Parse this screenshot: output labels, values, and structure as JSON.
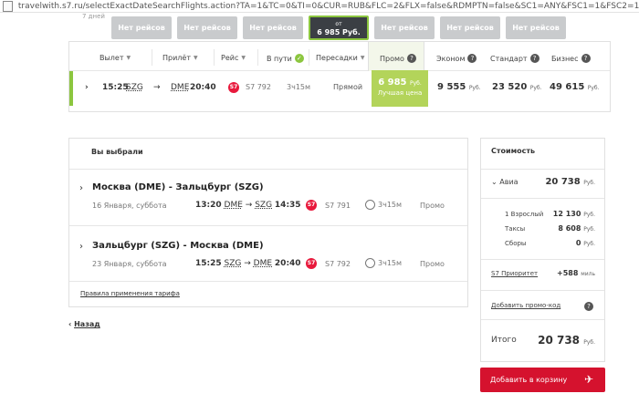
{
  "browser": {
    "url": "travelwith.s7.ru/selectExactDateSearchFlights.action?TA=1&TC=0&TI=0&CUR=RUB&FLC=2&FLX=false&RDMPTN=false&SC1=ANY&FSC1=1&FSC2=1&"
  },
  "date_tabs": {
    "side_label": "7 дней",
    "items": [
      {
        "label": "Нет рейсов"
      },
      {
        "label": "Нет рейсов"
      },
      {
        "label": "Нет рейсов"
      },
      {
        "label_top": "от",
        "label_bottom": "6 985 Руб."
      },
      {
        "label": "Нет рейсов"
      },
      {
        "label": "Нет рейсов"
      },
      {
        "label": "Нет рейсов"
      }
    ]
  },
  "columns": {
    "depart": "Вылет",
    "arrive": "Прилёт",
    "flight": "Рейс",
    "duration": "В пути",
    "stops": "Пересадки",
    "promo": "Промо",
    "economy": "Эконом",
    "standard": "Стандарт",
    "business": "Бизнес"
  },
  "flight_row": {
    "dep_time": "15:25",
    "dep_code": "SZG",
    "arrow": "→",
    "arr_code": "DME",
    "arr_time": "20:40",
    "airline": "S7",
    "flight_no": "S7 792",
    "duration": "3ч15м",
    "stops": "Прямой",
    "promo_price": "6 985",
    "promo_currency": "Руб.",
    "promo_note": "Лучшая цена",
    "economy_price": "9 555",
    "standard_price": "23 520",
    "business_price": "49 615",
    "currency": "Руб."
  },
  "chosen": {
    "title": "Вы выбрали",
    "segments": [
      {
        "route": "Москва (DME) - Зальцбург (SZG)",
        "date": "16 Января, суббота",
        "dep_time": "13:20",
        "dep_code": "DME",
        "arr_code": "SZG",
        "arr_time": "14:35",
        "flight_no": "S7 791",
        "duration": "3ч15м",
        "fare_class": "Промо"
      },
      {
        "route": "Зальцбург (SZG) - Москва (DME)",
        "date": "23 Января, суббота",
        "dep_time": "15:25",
        "dep_code": "SZG",
        "arr_code": "DME",
        "arr_time": "20:40",
        "flight_no": "S7 792",
        "duration": "3ч15м",
        "fare_class": "Промо"
      }
    ],
    "tariff_link": "Правила применения тарифа"
  },
  "back_link": "Назад",
  "cost": {
    "title": "Стоимость",
    "avia_label": "Авиа",
    "avia_value": "20 738",
    "adult_label": "1 Взрослый",
    "adult_value": "12 130",
    "taxes_label": "Таксы",
    "taxes_value": "8 608",
    "fees_label": "Сборы",
    "fees_value": "0",
    "currency": "Руб.",
    "priority_label": "S7 Приоритет",
    "priority_value": "+588",
    "priority_unit": "миль",
    "promo_code_label": "Добавить промо-код",
    "total_label": "Итого",
    "total_value": "20 738"
  },
  "cart_button": "Добавить в корзину",
  "colors": {
    "accent_green": "#8cc63f",
    "promo_green": "#b3d45a",
    "brand_red": "#d5122e"
  }
}
